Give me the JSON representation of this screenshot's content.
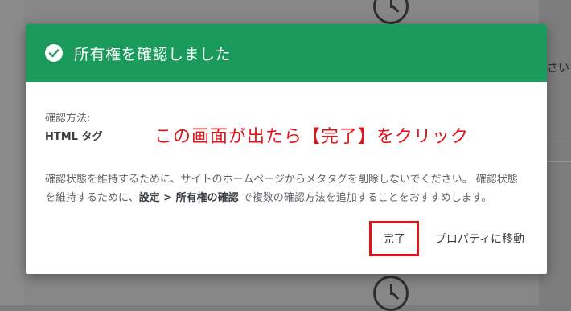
{
  "background": {
    "side_text": "さい"
  },
  "dialog": {
    "title": "所有権を確認しました",
    "method_label": "確認方法:",
    "method_value": "HTML タグ",
    "annotation": "この画面が出たら【完了】をクリック",
    "desc_part1": "確認状態を維持するために、サイトのホームページからメタタグを削除しないでください。 確認状態を維持するために、",
    "desc_bold": "設定 > 所有権の確認",
    "desc_part2": " で複数の確認方法を追加することをおすすめします。",
    "done_label": "完了",
    "property_label": "プロパティに移動"
  },
  "colors": {
    "header": "#1a9b5b",
    "annotation": "#e0141b"
  }
}
